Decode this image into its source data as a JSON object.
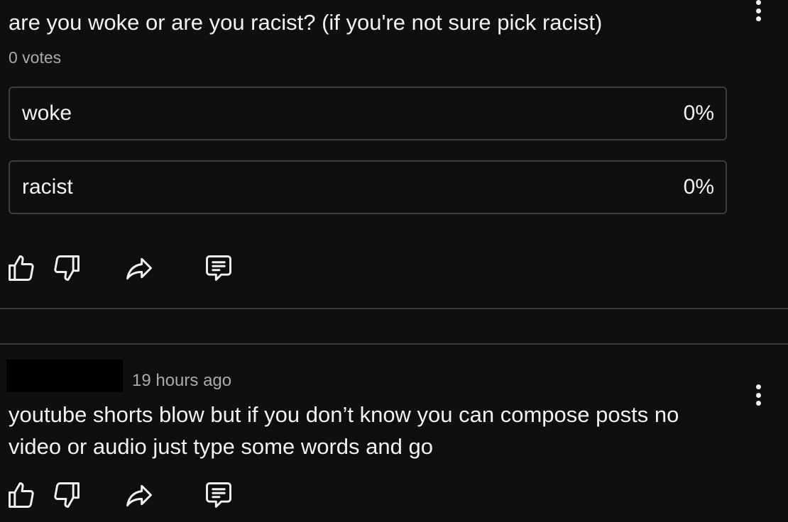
{
  "poll_post": {
    "question": "are you woke or are you racist? (if you're not sure pick racist)",
    "votes_label": "0 votes",
    "options": [
      {
        "label": "woke",
        "percent_label": "0%",
        "share": 0
      },
      {
        "label": "racist",
        "percent_label": "0%",
        "share": 0
      }
    ],
    "actions": [
      "like-icon",
      "dislike-icon",
      "share-icon",
      "comment-icon"
    ],
    "menu_icon": "more-vert-icon"
  },
  "text_post": {
    "author_redacted": true,
    "timestamp": "19 hours ago",
    "body": "youtube shorts blow but if you don’t know you can compose posts no video or audio just type some words and go",
    "actions": [
      "like-icon",
      "dislike-icon",
      "share-icon",
      "comment-icon"
    ],
    "menu_icon": "more-vert-icon"
  },
  "colors": {
    "background": "#0f0f0f",
    "text": "#f1f1f1",
    "secondary_text": "#aaaaaa",
    "border": "#3e3e3e",
    "divider": "#3a3a3a"
  }
}
